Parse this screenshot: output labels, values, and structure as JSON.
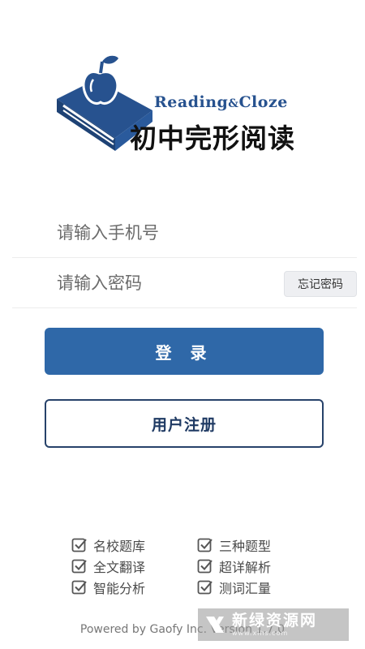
{
  "logo": {
    "english_text": "Reading",
    "ampersand": "&",
    "english_text_2": "Cloze",
    "chinese_title": "初中完形阅读",
    "icon": "book-apple-logo"
  },
  "form": {
    "phone_placeholder": "请输入手机号",
    "password_placeholder": "请输入密码",
    "forgot_label": "忘记密码"
  },
  "buttons": {
    "login_label": "登 录",
    "register_label": "用户注册"
  },
  "features": [
    {
      "label": "名校题库",
      "icon": "checkbox-checked-icon"
    },
    {
      "label": "三种题型",
      "icon": "checkbox-checked-icon"
    },
    {
      "label": "全文翻译",
      "icon": "checkbox-checked-icon"
    },
    {
      "label": "超详解析",
      "icon": "checkbox-checked-icon"
    },
    {
      "label": "智能分析",
      "icon": "checkbox-checked-icon"
    },
    {
      "label": "测词汇量",
      "icon": "checkbox-checked-icon"
    }
  ],
  "footer": {
    "text": "Powered by Gaofy Inc. Version 1.7.0"
  },
  "watermark": {
    "title": "新绿资源网",
    "url": "www.xlhs.com"
  },
  "colors": {
    "primary": "#2f68a8",
    "brand": "#27528f",
    "register_border": "#27426a"
  }
}
